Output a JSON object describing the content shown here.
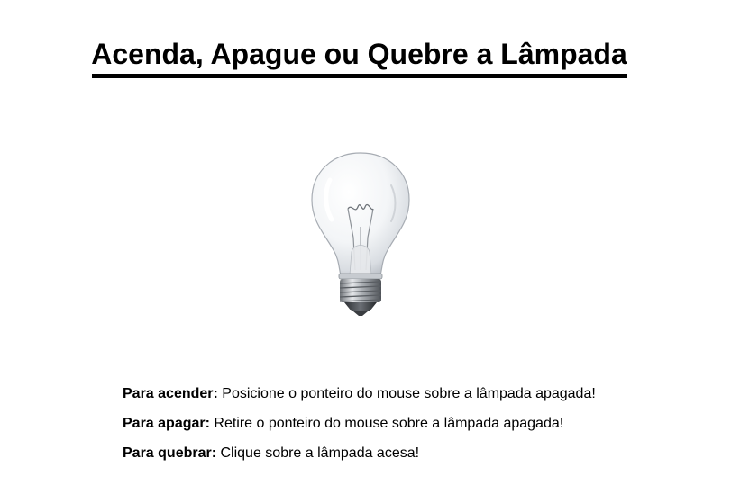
{
  "page": {
    "title": "Acenda, Apague ou Quebre a Lâmpada"
  },
  "bulb": {
    "state": "off",
    "icon": "light-bulb-icon"
  },
  "instructions": [
    {
      "label": "Para acender:",
      "text": " Posicione o ponteiro do mouse sobre a lâmpada apagada!"
    },
    {
      "label": "Para apagar:",
      "text": " Retire o ponteiro do mouse sobre a lâmpada apagada!"
    },
    {
      "label": "Para quebrar:",
      "text": " Clique sobre a lâmpada acesa!"
    }
  ]
}
